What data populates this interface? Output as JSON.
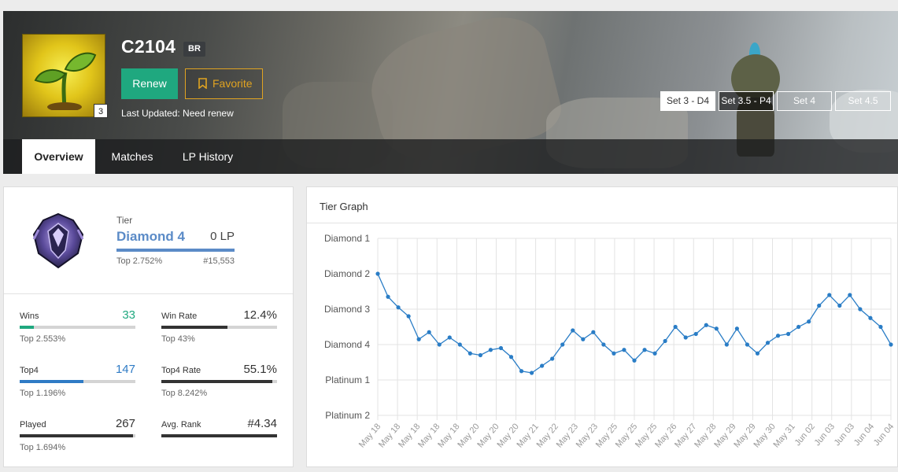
{
  "profile": {
    "name": "C2104",
    "region": "BR",
    "level": "3",
    "avatar_icon": "sprout-icon",
    "renew_label": "Renew",
    "favorite_label": "Favorite",
    "last_updated": "Last Updated: Need renew"
  },
  "seasons": [
    {
      "label": "Set 3 - D4",
      "state": "active"
    },
    {
      "label": "Set 3.5 - P4",
      "state": "hover"
    },
    {
      "label": "Set 4",
      "state": "normal"
    },
    {
      "label": "Set 4.5",
      "state": "normal"
    }
  ],
  "tabs": [
    {
      "label": "Overview",
      "active": true
    },
    {
      "label": "Matches",
      "active": false
    },
    {
      "label": "LP History",
      "active": false
    }
  ],
  "rank": {
    "tier_label": "Tier",
    "tier_name": "Diamond 4",
    "lp": "0 LP",
    "top_percent": "Top 2.752%",
    "rank_number": "#15,553",
    "emblem_icon": "diamond-emblem-icon"
  },
  "stats": [
    {
      "name": "Wins",
      "value": "33",
      "sub": "Top 2.553%",
      "fill": 0.124,
      "color": "#1fa87f",
      "value_color": "#1fa87f"
    },
    {
      "name": "Win Rate",
      "value": "12.4%",
      "sub": "Top 43%",
      "fill": 0.57,
      "color": "#333333",
      "value_color": "#333333"
    },
    {
      "name": "Top4",
      "value": "147",
      "sub": "Top 1.196%",
      "fill": 0.551,
      "color": "#2f7bc5",
      "value_color": "#2f7bc5"
    },
    {
      "name": "Top4 Rate",
      "value": "55.1%",
      "sub": "Top 8.242%",
      "fill": 0.96,
      "color": "#333333",
      "value_color": "#333333"
    },
    {
      "name": "Played",
      "value": "267",
      "sub": "Top 1.694%",
      "fill": 0.98,
      "color": "#333333",
      "value_color": "#333333"
    },
    {
      "name": "Avg. Rank",
      "value": "#4.34",
      "sub": "",
      "fill": 1.0,
      "color": "#333333",
      "value_color": "#333333"
    }
  ],
  "graph": {
    "title": "Tier Graph"
  },
  "chart_data": {
    "type": "line",
    "y_tick_labels": [
      "Diamond 1",
      "Diamond 2",
      "Diamond 3",
      "Diamond 4",
      "Platinum 1",
      "Platinum 2"
    ],
    "ylim": [
      0,
      5
    ],
    "x": [
      "May 18",
      "May 18",
      "May 18",
      "May 18",
      "May 18",
      "May 18",
      "May 18",
      "May 18",
      "May 18",
      "May 20",
      "May 20",
      "May 20",
      "May 20",
      "May 20",
      "May 20",
      "May 20",
      "May 21",
      "May 21",
      "May 22",
      "May 22",
      "May 23",
      "May 23",
      "May 23",
      "May 23",
      "May 23",
      "May 25",
      "May 25",
      "May 25",
      "May 25",
      "May 25",
      "May 25",
      "May 25",
      "May 26",
      "May 26",
      "May 27",
      "May 27",
      "May 27",
      "May 28",
      "May 28",
      "May 29",
      "May 29",
      "May 29",
      "May 29",
      "May 30",
      "May 30",
      "May 31",
      "May 31",
      "May 31",
      "Jun 02",
      "Jun 02",
      "Jun 02",
      "Jun 03",
      "Jun 03",
      "Jun 03",
      "Jun 03",
      "Jun 03",
      "Jun 04",
      "Jun 04",
      "Jun 04",
      "Jun 04"
    ],
    "x_tick_labels": [
      "May 18",
      "May 18",
      "May 18",
      "May 18",
      "May 18",
      "May 20",
      "May 20",
      "May 20",
      "May 21",
      "May 22",
      "May 23",
      "May 23",
      "May 25",
      "May 25",
      "May 25",
      "May 26",
      "May 27",
      "May 28",
      "May 29",
      "May 29",
      "May 30",
      "May 31",
      "Jun 02",
      "Jun 03",
      "Jun 03",
      "Jun 04",
      "Jun 04"
    ],
    "values": [
      4.0,
      3.35,
      3.05,
      2.8,
      2.15,
      2.35,
      2.0,
      2.2,
      2.0,
      1.75,
      1.7,
      1.85,
      1.9,
      1.65,
      1.25,
      1.2,
      1.4,
      1.6,
      2.0,
      2.4,
      2.15,
      2.35,
      2.0,
      1.75,
      1.85,
      1.55,
      1.85,
      1.75,
      2.1,
      2.5,
      2.2,
      2.3,
      2.55,
      2.45,
      2.0,
      2.45,
      2.0,
      1.75,
      2.05,
      2.25,
      2.3,
      2.5,
      2.65,
      3.1,
      3.4,
      3.1,
      3.4,
      3.0,
      2.75,
      2.5,
      2.0
    ],
    "line_color": "#2a7dc6",
    "grid": true
  }
}
